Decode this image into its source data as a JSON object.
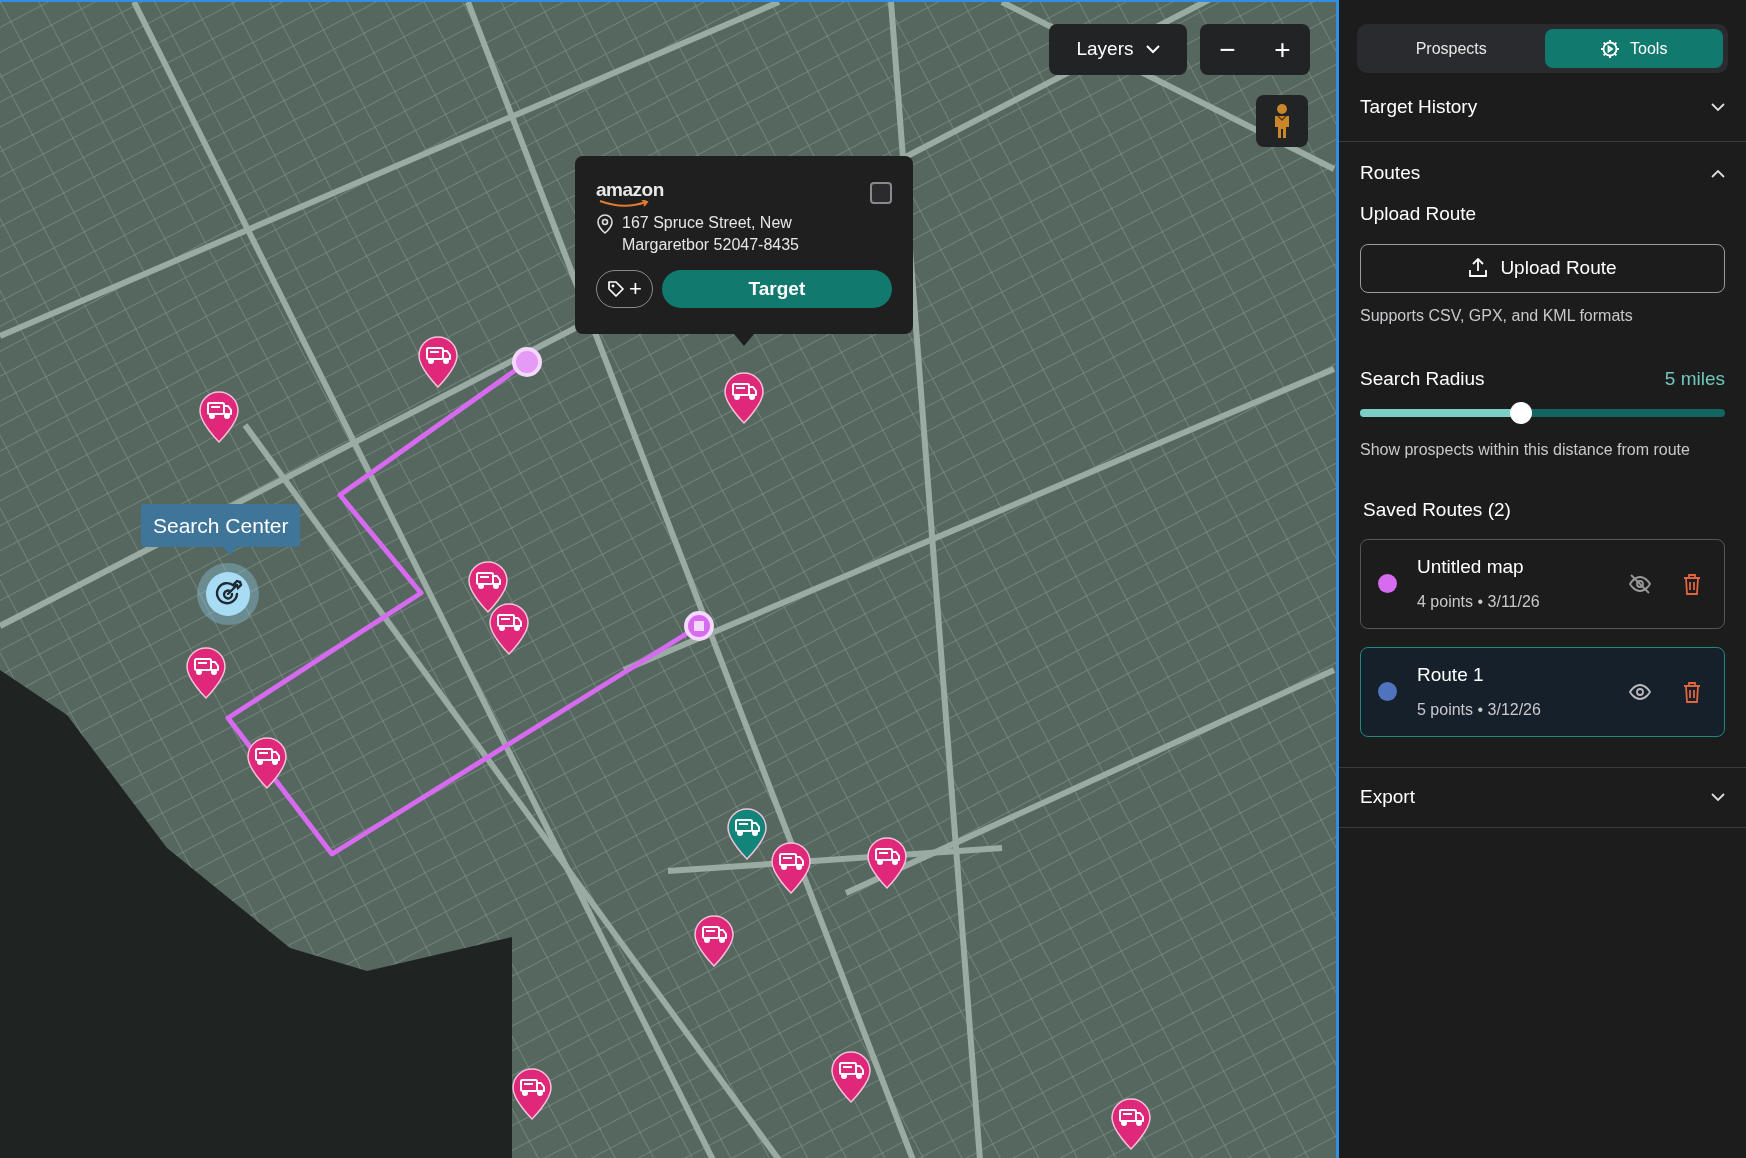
{
  "map": {
    "layers_button": {
      "label": "Layers"
    },
    "zoom_controls": {
      "zoom_out": "−",
      "zoom_in": "+"
    },
    "search_center": {
      "label": "Search Center"
    },
    "popup": {
      "brand": "amazon",
      "address": "167 Spruce Street, New Margaretbor 52047-8435",
      "checked": false,
      "tag_button": {
        "label": "+"
      },
      "target_button": {
        "label": "Target"
      }
    },
    "markers": [
      {
        "color": "#e0287a"
      },
      {
        "color": "#e0287a"
      },
      {
        "color": "#e0287a"
      },
      {
        "color": "#e0287a"
      },
      {
        "color": "#e0287a"
      },
      {
        "color": "#e0287a"
      },
      {
        "color": "#e0287a"
      },
      {
        "color": "#e0287a"
      },
      {
        "color": "#e0287a"
      },
      {
        "color": "#e0287a"
      },
      {
        "color": "#e0287a"
      },
      {
        "color": "#e0287a"
      },
      {
        "color": "#e0287a"
      },
      {
        "color": "#12857a"
      }
    ]
  },
  "panel": {
    "tabs": [
      {
        "label": "Prospects",
        "selected": false
      },
      {
        "label": "Tools",
        "selected": true
      }
    ],
    "sections": [
      {
        "title": "Target History",
        "expanded": false
      },
      {
        "title": "Routes",
        "expanded": true,
        "upload": {
          "title": "Upload Route",
          "button": "Upload Route",
          "hint": "Supports CSV, GPX, and KML formats"
        },
        "radius": {
          "label": "Search Radius",
          "value": "5 miles",
          "level": 0.44,
          "hint": "Show prospects within this distance from route"
        },
        "saved_title": "Saved Routes (2)",
        "saved_routes": [
          {
            "name": "Untitled map",
            "meta": "4 points • 3/11/26",
            "color": "#d66bf0",
            "visible": false,
            "selected": false
          },
          {
            "name": "Route 1",
            "meta": "5 points • 3/12/26",
            "color": "#4f73bd",
            "visible": true,
            "selected": true
          }
        ]
      },
      {
        "title": "Export",
        "expanded": false
      }
    ]
  }
}
